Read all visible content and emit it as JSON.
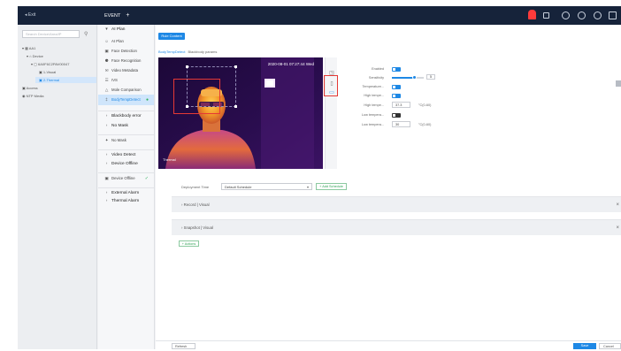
{
  "topbar": {
    "exit_label": "Exit",
    "tab_label": "EVENT",
    "tab_add": "+",
    "icons": [
      "alarm-icon",
      "record-icon",
      "settings-icon",
      "display-icon",
      "help-icon"
    ]
  },
  "tree": {
    "search_placeholder": "Search Device/Area/IP",
    "nodes": [
      {
        "label": "▾ ▦ AA1"
      },
      {
        "label": "▾ ⌂ Device"
      },
      {
        "label": "▾ ▢ 6A0F6C2PAV00047"
      },
      {
        "label": "▣ 1-Visual"
      },
      {
        "label": "▣ 2-Thermal"
      },
      {
        "label": "▣ Access"
      },
      {
        "label": "◉ NTP Media"
      }
    ]
  },
  "rules": {
    "items": [
      {
        "icon": "▾",
        "label": "AI Plan"
      },
      {
        "icon": "☺",
        "label": "AI Plan"
      },
      {
        "icon": "▣",
        "label": "Face Detection"
      },
      {
        "icon": "⚈",
        "label": "Face Recognition"
      },
      {
        "icon": "✉",
        "label": "Video Metadata"
      },
      {
        "icon": "☰",
        "label": "IVS"
      },
      {
        "icon": "△",
        "label": "Mole Comparison"
      },
      {
        "icon": "‡",
        "label": "BodyTempDetect"
      },
      {
        "icon": "›",
        "label": "Blackbody error"
      },
      {
        "icon": "›",
        "label": "No Mask"
      },
      {
        "icon": "✦",
        "label": "No Mask"
      },
      {
        "icon": "›",
        "label": "Video Detect"
      },
      {
        "icon": "›",
        "label": "Device Offline"
      },
      {
        "icon": "▣",
        "label": "Device Offline"
      },
      {
        "icon": "›",
        "label": "External Alarm"
      },
      {
        "icon": "›",
        "label": "Thermal Alarm"
      }
    ]
  },
  "main": {
    "rule_button": "Rule Content",
    "breadcrumb_active": "BodyTempDetect",
    "breadcrumb_rest": "Blackbody params",
    "timestamp": "2020-08-01 07:27:44 Wed",
    "channel": "Thermal",
    "form": {
      "enabled_label": "Enabled",
      "sensitivity_label": "Sensitivity",
      "sensitivity_value": "5",
      "sensitivity_fraction": 0.7,
      "temperature_label": "Temperature...",
      "high_temp_toggle_label": "High tempe...",
      "high_temp_label": "High tempe...",
      "high_temp_value": "37.3",
      "high_temp_unit": "°C(0-60)",
      "low_temp_toggle_label": "Low tempera...",
      "low_temp_label": "Low tempera...",
      "low_temp_value": "30",
      "low_temp_unit": "°C(0-60)"
    },
    "schedule_label": "Deployment Time",
    "schedule_value": "Default Schedule",
    "add_schedule": "+ Add Schedule",
    "section_record": "Record | Visual",
    "section_snapshot": "Snapshot | Visual",
    "actions_button": "+ Actions",
    "refresh_label": "Refresh",
    "save_label": "Save",
    "cancel_label": "Cancel"
  },
  "colors": {
    "accent": "#1e88e5",
    "topbar": "#16233a",
    "alarm": "#ff3b3b",
    "success": "#30b35c"
  }
}
